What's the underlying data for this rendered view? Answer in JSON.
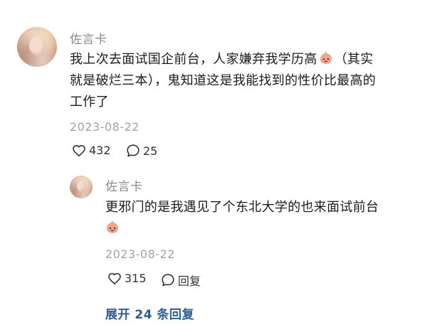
{
  "main_comment": {
    "username": "佐言卡",
    "text_before_emoji": "我上次去面试国企前台，人家嫌弃我学历高",
    "text_after_emoji_line1": "（其实",
    "text_line2": "就是破烂三本），鬼知道这是我能找到的性价比最高的",
    "text_line3": "工作了",
    "date": "2023-08-22",
    "like_count": "432",
    "reply_count": "25",
    "emoji_icon": "peach-face-icon"
  },
  "reply_comment": {
    "username": "佐言卡",
    "text": "更邪门的是我遇见了个东北大学的也来面试前台",
    "emoji_icon": "peach-face-icon",
    "date": "2023-08-22",
    "like_count": "315",
    "reply_label": "回复"
  },
  "expand_replies": {
    "label": "展开 24 条回复"
  },
  "colors": {
    "text": "#1b1b1b",
    "meta": "#8a8a8a",
    "link": "#2b5c98",
    "emoji_peach": "#f4a48d"
  }
}
